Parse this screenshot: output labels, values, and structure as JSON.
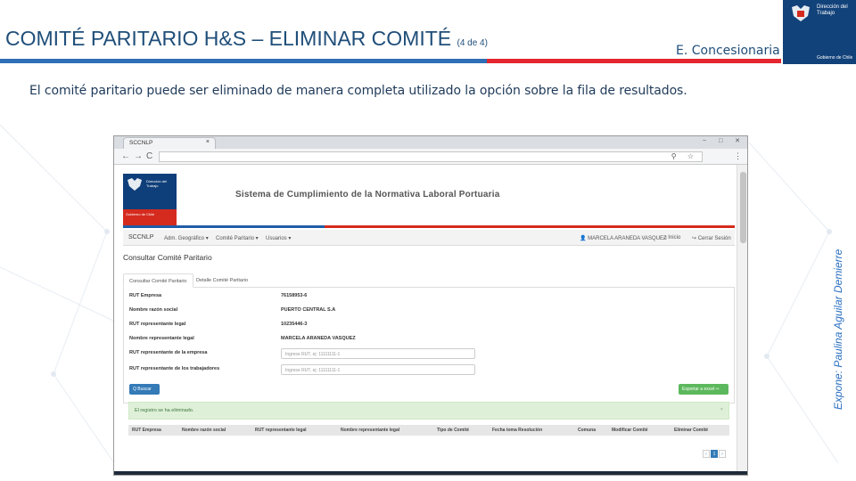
{
  "slide": {
    "title": "COMITÉ PARITARIO H&S – ELIMINAR COMITÉ",
    "title_suffix": "(4 de 4)",
    "section": "E. Concesionaria",
    "description": "El comité paritario puede ser eliminado de manera completa utilizado la opción sobre la fila de resultados.",
    "presenter": "Expone: Paulina Aguilar Demierre",
    "logo_text_top": "Dirección del Trabajo",
    "logo_text_bottom": "Gobierno de Chile",
    "colors": {
      "blue": "#2e6fb6",
      "red": "#e3262f",
      "navy": "#12427a",
      "title": "#1f4e79"
    }
  },
  "browser": {
    "tab_title": "SCCNLP",
    "window_buttons": "− □ ✕",
    "nav": {
      "back": "←",
      "forward": "→",
      "reload": "C"
    },
    "omni_icons": "⚲ ☆",
    "menu": "⋮"
  },
  "app": {
    "logo_text": "Dirección del Trabajo",
    "logo_sub": "Gobierno de Chile",
    "system_title": "Sistema de Cumplimiento de la Normativa Laboral Portuaria",
    "navbar": {
      "brand": "SCCNLP",
      "items": [
        "Adm. Geográfico ▾",
        "Comité Paritario ▾",
        "Usuarios ▾"
      ],
      "user": "MARCELA ARANEDA VASQUEZ",
      "home": "Inicio",
      "logout": "Cerrar Sesión"
    },
    "content_title": "Consultar Comité Paritario",
    "tabs": [
      "Consultar Comité Paritario",
      "Detalle Comité Paritario"
    ],
    "form": {
      "rut_empresa_label": "RUT Empresa",
      "rut_empresa": "76158953-6",
      "razon_social_label": "Nombre razón social",
      "razon_social": "PUERTO CENTRAL S.A",
      "rut_rep_legal_label": "RUT representante legal",
      "rut_rep_legal": "10235446-3",
      "nombre_rep_legal_label": "Nombre representante legal",
      "nombre_rep_legal": "MARCELA ARANEDA VASQUEZ",
      "rut_rep_empresa_label": "RUT representante de la empresa",
      "rut_rep_empresa_placeholder": "Ingrese RUT, ej: 11111111-1",
      "rut_rep_trab_label": "RUT representante de los trabajadores",
      "rut_rep_trab_placeholder": "Ingrese RUT, ej: 11111111-1",
      "search_button": "Q Buscar",
      "export_button": "Exportar a excel ⇨"
    },
    "alert": "El registro se ha eliminado.",
    "alert_close": "×",
    "table_headers": [
      "RUT Empresa",
      "Nombre razón social",
      "RUT representante legal",
      "Nombre representante legal",
      "Tipo de Comité",
      "Fecha toma Resolución",
      "Comuna",
      "Modificar Comité",
      "Eliminar Comité"
    ],
    "pager": [
      "‹",
      "1",
      "›"
    ]
  }
}
